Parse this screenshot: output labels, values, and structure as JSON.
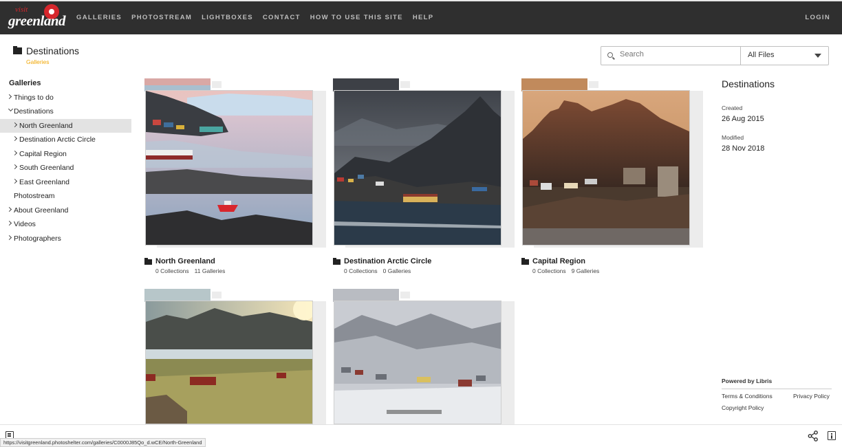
{
  "brand": {
    "visit": "visit",
    "word": "greenland",
    "accent": "#d6262c"
  },
  "nav": {
    "items": [
      "GALLERIES",
      "PHOTOSTREAM",
      "LIGHTBOXES",
      "CONTACT",
      "HOW TO USE THIS SITE",
      "HELP"
    ],
    "login": "LOGIN"
  },
  "header": {
    "title": "Destinations",
    "subtitle": "Galleries",
    "subtitle_color": "#f0a500"
  },
  "search": {
    "placeholder": "Search",
    "filter_selected": "All Files"
  },
  "tree": {
    "heading": "Galleries",
    "items": [
      {
        "label": "Things to do"
      },
      {
        "label": "Destinations"
      },
      {
        "label": "North Greenland"
      },
      {
        "label": "Destination Arctic Circle"
      },
      {
        "label": "Capital Region"
      },
      {
        "label": "South Greenland"
      },
      {
        "label": "East Greenland"
      },
      {
        "label": "Photostream"
      },
      {
        "label": "About Greenland"
      },
      {
        "label": "Videos"
      },
      {
        "label": "Photographers"
      }
    ]
  },
  "cards": [
    {
      "title": "North Greenland",
      "collections": "0 Collections",
      "galleries": "11 Galleries"
    },
    {
      "title": "Destination Arctic Circle",
      "collections": "0 Collections",
      "galleries": "0 Galleries"
    },
    {
      "title": "Capital Region",
      "collections": "0 Collections",
      "galleries": "9 Galleries"
    },
    {
      "title": "",
      "collections": "",
      "galleries": ""
    },
    {
      "title": "",
      "collections": "",
      "galleries": ""
    }
  ],
  "details": {
    "title": "Destinations",
    "created_label": "Created",
    "created": "26 Aug 2015",
    "modified_label": "Modified",
    "modified": "28 Nov 2018"
  },
  "footer": {
    "powered": "Powered by Libris",
    "terms": "Terms & Conditions",
    "privacy": "Privacy Policy",
    "copyright": "Copyright Policy"
  },
  "status_url": "https://visitgreenland.photoshelter.com/galleries/C0000J85Qo_d.wCE/North-Greenland"
}
